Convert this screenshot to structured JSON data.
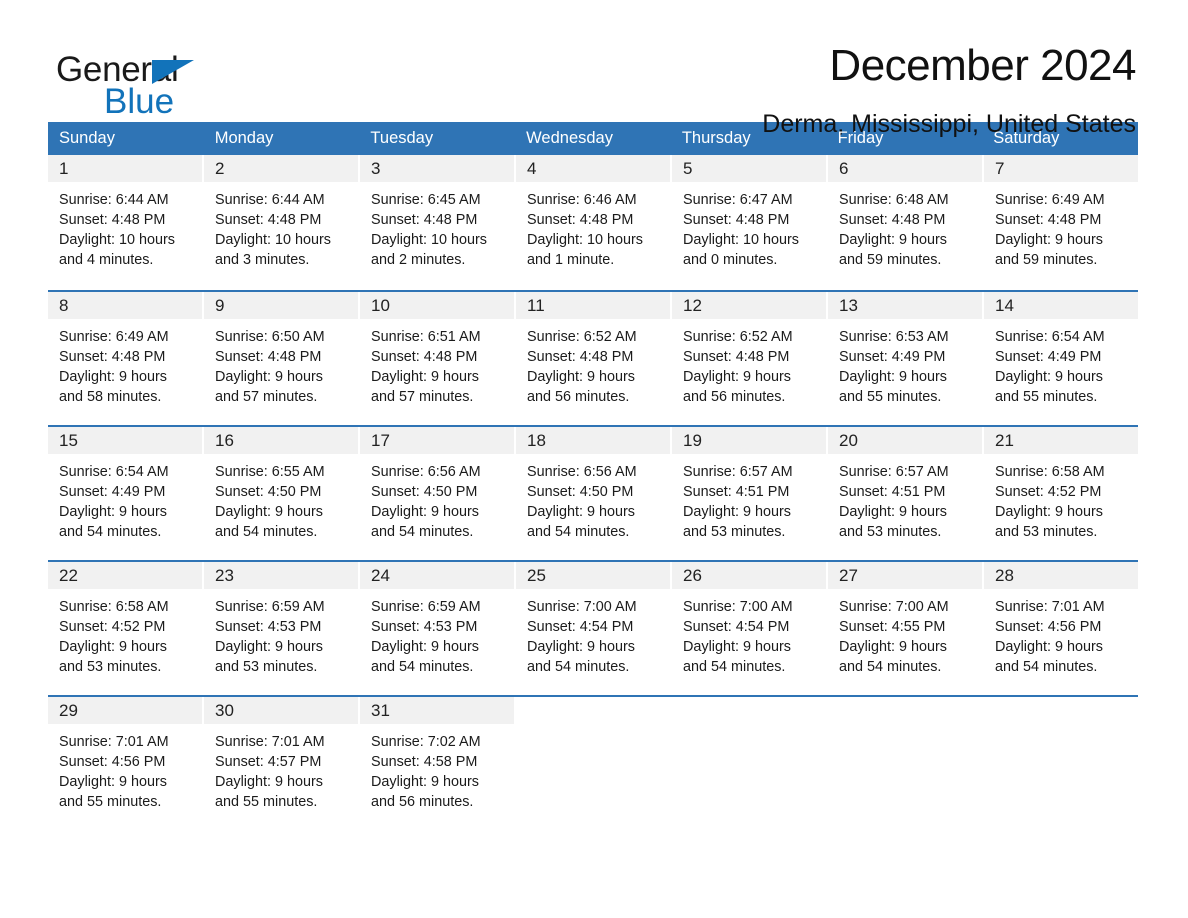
{
  "brand": {
    "name_part1": "General",
    "name_part2": "Blue",
    "triangle_color": "#1273ba",
    "blue_text_color": "#1273ba"
  },
  "header": {
    "title": "December 2024",
    "subtitle": "Derma, Mississippi, United States"
  },
  "theme": {
    "header_blue": "#2f74b5",
    "daynum_band": "#f1f1f1",
    "text": "#1b1b1b"
  },
  "calendar": {
    "day_headers": [
      "Sunday",
      "Monday",
      "Tuesday",
      "Wednesday",
      "Thursday",
      "Friday",
      "Saturday"
    ],
    "weeks": [
      [
        {
          "day": "1",
          "sunrise": "Sunrise: 6:44 AM",
          "sunset": "Sunset: 4:48 PM",
          "daylight_line1": "Daylight: 10 hours",
          "daylight_line2": "and 4 minutes."
        },
        {
          "day": "2",
          "sunrise": "Sunrise: 6:44 AM",
          "sunset": "Sunset: 4:48 PM",
          "daylight_line1": "Daylight: 10 hours",
          "daylight_line2": "and 3 minutes."
        },
        {
          "day": "3",
          "sunrise": "Sunrise: 6:45 AM",
          "sunset": "Sunset: 4:48 PM",
          "daylight_line1": "Daylight: 10 hours",
          "daylight_line2": "and 2 minutes."
        },
        {
          "day": "4",
          "sunrise": "Sunrise: 6:46 AM",
          "sunset": "Sunset: 4:48 PM",
          "daylight_line1": "Daylight: 10 hours",
          "daylight_line2": "and 1 minute."
        },
        {
          "day": "5",
          "sunrise": "Sunrise: 6:47 AM",
          "sunset": "Sunset: 4:48 PM",
          "daylight_line1": "Daylight: 10 hours",
          "daylight_line2": "and 0 minutes."
        },
        {
          "day": "6",
          "sunrise": "Sunrise: 6:48 AM",
          "sunset": "Sunset: 4:48 PM",
          "daylight_line1": "Daylight: 9 hours",
          "daylight_line2": "and 59 minutes."
        },
        {
          "day": "7",
          "sunrise": "Sunrise: 6:49 AM",
          "sunset": "Sunset: 4:48 PM",
          "daylight_line1": "Daylight: 9 hours",
          "daylight_line2": "and 59 minutes."
        }
      ],
      [
        {
          "day": "8",
          "sunrise": "Sunrise: 6:49 AM",
          "sunset": "Sunset: 4:48 PM",
          "daylight_line1": "Daylight: 9 hours",
          "daylight_line2": "and 58 minutes."
        },
        {
          "day": "9",
          "sunrise": "Sunrise: 6:50 AM",
          "sunset": "Sunset: 4:48 PM",
          "daylight_line1": "Daylight: 9 hours",
          "daylight_line2": "and 57 minutes."
        },
        {
          "day": "10",
          "sunrise": "Sunrise: 6:51 AM",
          "sunset": "Sunset: 4:48 PM",
          "daylight_line1": "Daylight: 9 hours",
          "daylight_line2": "and 57 minutes."
        },
        {
          "day": "11",
          "sunrise": "Sunrise: 6:52 AM",
          "sunset": "Sunset: 4:48 PM",
          "daylight_line1": "Daylight: 9 hours",
          "daylight_line2": "and 56 minutes."
        },
        {
          "day": "12",
          "sunrise": "Sunrise: 6:52 AM",
          "sunset": "Sunset: 4:48 PM",
          "daylight_line1": "Daylight: 9 hours",
          "daylight_line2": "and 56 minutes."
        },
        {
          "day": "13",
          "sunrise": "Sunrise: 6:53 AM",
          "sunset": "Sunset: 4:49 PM",
          "daylight_line1": "Daylight: 9 hours",
          "daylight_line2": "and 55 minutes."
        },
        {
          "day": "14",
          "sunrise": "Sunrise: 6:54 AM",
          "sunset": "Sunset: 4:49 PM",
          "daylight_line1": "Daylight: 9 hours",
          "daylight_line2": "and 55 minutes."
        }
      ],
      [
        {
          "day": "15",
          "sunrise": "Sunrise: 6:54 AM",
          "sunset": "Sunset: 4:49 PM",
          "daylight_line1": "Daylight: 9 hours",
          "daylight_line2": "and 54 minutes."
        },
        {
          "day": "16",
          "sunrise": "Sunrise: 6:55 AM",
          "sunset": "Sunset: 4:50 PM",
          "daylight_line1": "Daylight: 9 hours",
          "daylight_line2": "and 54 minutes."
        },
        {
          "day": "17",
          "sunrise": "Sunrise: 6:56 AM",
          "sunset": "Sunset: 4:50 PM",
          "daylight_line1": "Daylight: 9 hours",
          "daylight_line2": "and 54 minutes."
        },
        {
          "day": "18",
          "sunrise": "Sunrise: 6:56 AM",
          "sunset": "Sunset: 4:50 PM",
          "daylight_line1": "Daylight: 9 hours",
          "daylight_line2": "and 54 minutes."
        },
        {
          "day": "19",
          "sunrise": "Sunrise: 6:57 AM",
          "sunset": "Sunset: 4:51 PM",
          "daylight_line1": "Daylight: 9 hours",
          "daylight_line2": "and 53 minutes."
        },
        {
          "day": "20",
          "sunrise": "Sunrise: 6:57 AM",
          "sunset": "Sunset: 4:51 PM",
          "daylight_line1": "Daylight: 9 hours",
          "daylight_line2": "and 53 minutes."
        },
        {
          "day": "21",
          "sunrise": "Sunrise: 6:58 AM",
          "sunset": "Sunset: 4:52 PM",
          "daylight_line1": "Daylight: 9 hours",
          "daylight_line2": "and 53 minutes."
        }
      ],
      [
        {
          "day": "22",
          "sunrise": "Sunrise: 6:58 AM",
          "sunset": "Sunset: 4:52 PM",
          "daylight_line1": "Daylight: 9 hours",
          "daylight_line2": "and 53 minutes."
        },
        {
          "day": "23",
          "sunrise": "Sunrise: 6:59 AM",
          "sunset": "Sunset: 4:53 PM",
          "daylight_line1": "Daylight: 9 hours",
          "daylight_line2": "and 53 minutes."
        },
        {
          "day": "24",
          "sunrise": "Sunrise: 6:59 AM",
          "sunset": "Sunset: 4:53 PM",
          "daylight_line1": "Daylight: 9 hours",
          "daylight_line2": "and 54 minutes."
        },
        {
          "day": "25",
          "sunrise": "Sunrise: 7:00 AM",
          "sunset": "Sunset: 4:54 PM",
          "daylight_line1": "Daylight: 9 hours",
          "daylight_line2": "and 54 minutes."
        },
        {
          "day": "26",
          "sunrise": "Sunrise: 7:00 AM",
          "sunset": "Sunset: 4:54 PM",
          "daylight_line1": "Daylight: 9 hours",
          "daylight_line2": "and 54 minutes."
        },
        {
          "day": "27",
          "sunrise": "Sunrise: 7:00 AM",
          "sunset": "Sunset: 4:55 PM",
          "daylight_line1": "Daylight: 9 hours",
          "daylight_line2": "and 54 minutes."
        },
        {
          "day": "28",
          "sunrise": "Sunrise: 7:01 AM",
          "sunset": "Sunset: 4:56 PM",
          "daylight_line1": "Daylight: 9 hours",
          "daylight_line2": "and 54 minutes."
        }
      ],
      [
        {
          "day": "29",
          "sunrise": "Sunrise: 7:01 AM",
          "sunset": "Sunset: 4:56 PM",
          "daylight_line1": "Daylight: 9 hours",
          "daylight_line2": "and 55 minutes."
        },
        {
          "day": "30",
          "sunrise": "Sunrise: 7:01 AM",
          "sunset": "Sunset: 4:57 PM",
          "daylight_line1": "Daylight: 9 hours",
          "daylight_line2": "and 55 minutes."
        },
        {
          "day": "31",
          "sunrise": "Sunrise: 7:02 AM",
          "sunset": "Sunset: 4:58 PM",
          "daylight_line1": "Daylight: 9 hours",
          "daylight_line2": "and 56 minutes."
        },
        {
          "day": "",
          "sunrise": "",
          "sunset": "",
          "daylight_line1": "",
          "daylight_line2": ""
        },
        {
          "day": "",
          "sunrise": "",
          "sunset": "",
          "daylight_line1": "",
          "daylight_line2": ""
        },
        {
          "day": "",
          "sunrise": "",
          "sunset": "",
          "daylight_line1": "",
          "daylight_line2": ""
        },
        {
          "day": "",
          "sunrise": "",
          "sunset": "",
          "daylight_line1": "",
          "daylight_line2": ""
        }
      ]
    ]
  }
}
